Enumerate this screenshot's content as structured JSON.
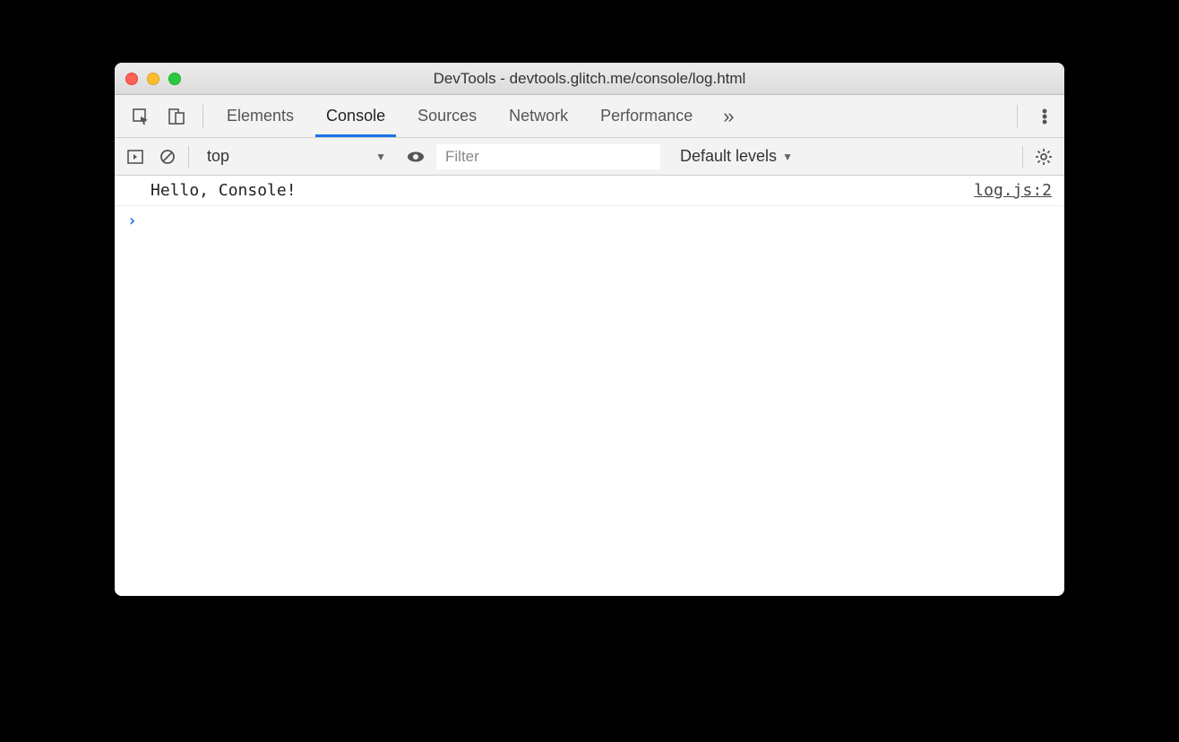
{
  "window": {
    "title": "DevTools - devtools.glitch.me/console/log.html"
  },
  "tabs": {
    "items": [
      "Elements",
      "Console",
      "Sources",
      "Network",
      "Performance"
    ],
    "active": "Console"
  },
  "subbar": {
    "context": "top",
    "filter_placeholder": "Filter",
    "levels": "Default levels"
  },
  "console": {
    "logs": [
      {
        "message": "Hello, Console!",
        "source": "log.js:2"
      }
    ]
  }
}
